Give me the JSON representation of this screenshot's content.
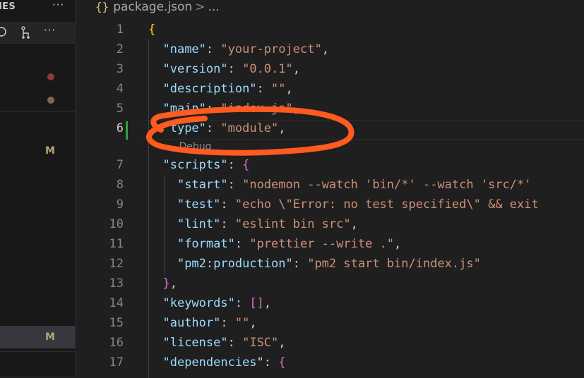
{
  "sidebar": {
    "title": "IES",
    "more_icon": "ellipsis-icon",
    "toolbar": {
      "refresh_icon": "refresh-icon",
      "branch_icon": "source-control-graph-icon",
      "more_icon": "ellipsis-icon"
    },
    "badges": [
      "M",
      "M"
    ],
    "dot_colors": [
      "#8a3b3d",
      "#7d6a4b"
    ]
  },
  "breadcrumb": {
    "icon": "{}",
    "file": "package.json",
    "separator": ">",
    "tail": "..."
  },
  "editor": {
    "current_line": 6,
    "codelens": "Debug",
    "annotation_color": "#ff5a1f",
    "lines": [
      {
        "n": "1",
        "tokens": [
          [
            "b1",
            "{"
          ]
        ]
      },
      {
        "n": "2",
        "tokens": [
          [
            "p",
            "  "
          ],
          [
            "k",
            "\"name\""
          ],
          [
            "p",
            ": "
          ],
          [
            "s",
            "\"your-project\""
          ],
          [
            "p",
            ","
          ]
        ]
      },
      {
        "n": "3",
        "tokens": [
          [
            "p",
            "  "
          ],
          [
            "k",
            "\"version\""
          ],
          [
            "p",
            ": "
          ],
          [
            "s",
            "\"0.0.1\""
          ],
          [
            "p",
            ","
          ]
        ]
      },
      {
        "n": "4",
        "tokens": [
          [
            "p",
            "  "
          ],
          [
            "k",
            "\"description\""
          ],
          [
            "p",
            ": "
          ],
          [
            "s",
            "\"\""
          ],
          [
            "p",
            ","
          ]
        ]
      },
      {
        "n": "5",
        "tokens": [
          [
            "p",
            "  "
          ],
          [
            "k",
            "\"main\""
          ],
          [
            "p",
            ": "
          ],
          [
            "s",
            "\"index.js\""
          ],
          [
            "p",
            ","
          ]
        ]
      },
      {
        "n": "6",
        "tokens": [
          [
            "p",
            "  "
          ],
          [
            "k",
            "\"type\""
          ],
          [
            "p",
            ": "
          ],
          [
            "s",
            "\"module\""
          ],
          [
            "p",
            ","
          ]
        ]
      },
      {
        "n": "7",
        "tokens": [
          [
            "p",
            "  "
          ],
          [
            "k",
            "\"scripts\""
          ],
          [
            "p",
            ": "
          ],
          [
            "b2",
            "{"
          ]
        ]
      },
      {
        "n": "8",
        "tokens": [
          [
            "p",
            "    "
          ],
          [
            "k",
            "\"start\""
          ],
          [
            "p",
            ": "
          ],
          [
            "s",
            "\"nodemon --watch 'bin/*' --watch 'src/*' "
          ]
        ]
      },
      {
        "n": "9",
        "tokens": [
          [
            "p",
            "    "
          ],
          [
            "k",
            "\"test\""
          ],
          [
            "p",
            ": "
          ],
          [
            "s",
            "\"echo \\\"Error: no test specified\\\" && exit"
          ]
        ]
      },
      {
        "n": "10",
        "tokens": [
          [
            "p",
            "    "
          ],
          [
            "k",
            "\"lint\""
          ],
          [
            "p",
            ": "
          ],
          [
            "s",
            "\"eslint bin src\""
          ],
          [
            "p",
            ","
          ]
        ]
      },
      {
        "n": "11",
        "tokens": [
          [
            "p",
            "    "
          ],
          [
            "k",
            "\"format\""
          ],
          [
            "p",
            ": "
          ],
          [
            "s",
            "\"prettier --write .\""
          ],
          [
            "p",
            ","
          ]
        ]
      },
      {
        "n": "12",
        "tokens": [
          [
            "p",
            "    "
          ],
          [
            "k",
            "\"pm2:production\""
          ],
          [
            "p",
            ": "
          ],
          [
            "s",
            "\"pm2 start bin/index.js\""
          ]
        ]
      },
      {
        "n": "13",
        "tokens": [
          [
            "p",
            "  "
          ],
          [
            "b2",
            "}"
          ],
          [
            "p",
            ","
          ]
        ]
      },
      {
        "n": "14",
        "tokens": [
          [
            "p",
            "  "
          ],
          [
            "k",
            "\"keywords\""
          ],
          [
            "p",
            ": "
          ],
          [
            "b2",
            "[]"
          ],
          [
            "p",
            ","
          ]
        ]
      },
      {
        "n": "15",
        "tokens": [
          [
            "p",
            "  "
          ],
          [
            "k",
            "\"author\""
          ],
          [
            "p",
            ": "
          ],
          [
            "s",
            "\"\""
          ],
          [
            "p",
            ","
          ]
        ]
      },
      {
        "n": "16",
        "tokens": [
          [
            "p",
            "  "
          ],
          [
            "k",
            "\"license\""
          ],
          [
            "p",
            ": "
          ],
          [
            "s",
            "\"ISC\""
          ],
          [
            "p",
            ","
          ]
        ]
      },
      {
        "n": "17",
        "tokens": [
          [
            "p",
            "  "
          ],
          [
            "k",
            "\"dependencies\""
          ],
          [
            "p",
            ": "
          ],
          [
            "b2",
            "{"
          ]
        ]
      }
    ]
  }
}
